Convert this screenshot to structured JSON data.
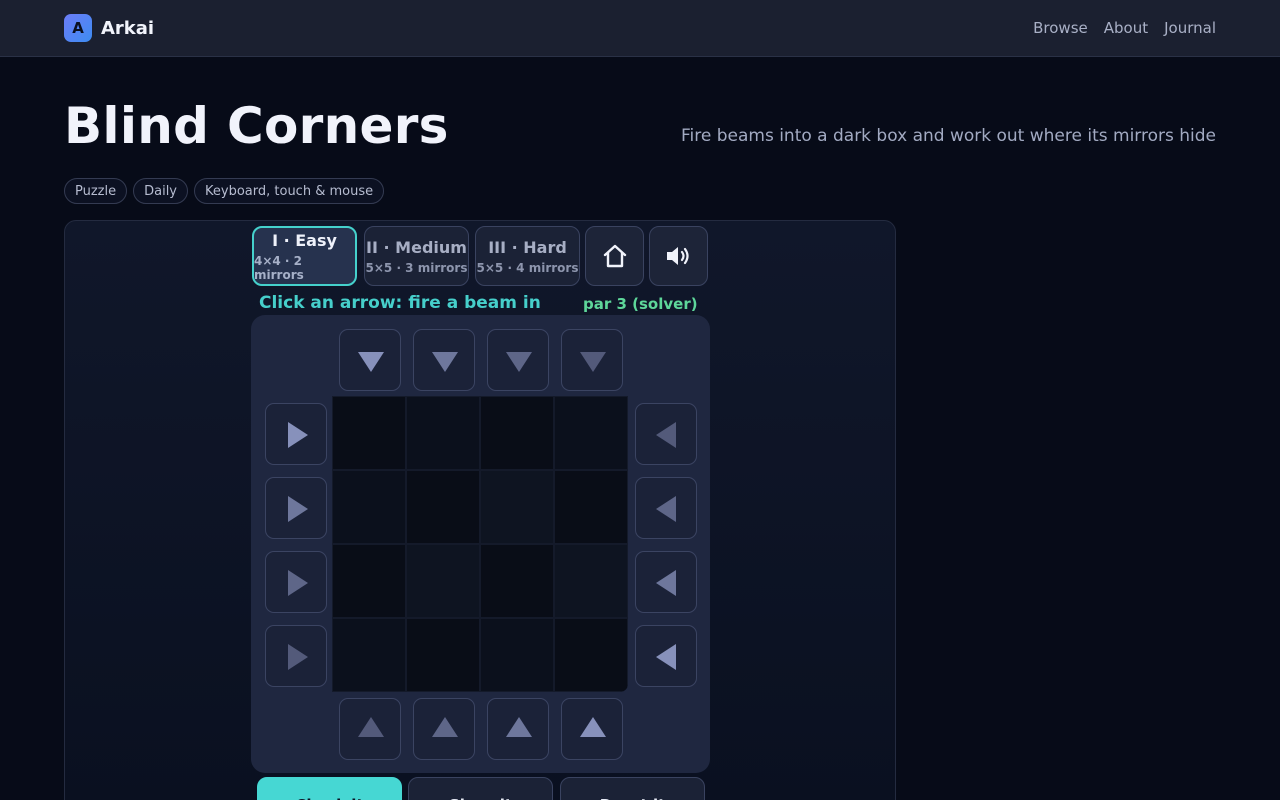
{
  "nav": {
    "brand_letter": "A",
    "brand_name": "Arkai",
    "links": [
      "Browse",
      "About",
      "Journal"
    ]
  },
  "header": {
    "title": "Blind Corners",
    "subtitle": "Fire beams into a dark box and work out where its mirrors hide",
    "tags": [
      "Puzzle",
      "Daily",
      "Keyboard, touch & mouse"
    ]
  },
  "levels": [
    {
      "name": "I · Easy",
      "desc": "4×4 · 2 mirrors",
      "active": true
    },
    {
      "name": "II · Medium",
      "desc": "5×5 · 3 mirrors",
      "active": false
    },
    {
      "name": "III · Hard",
      "desc": "5×5 · 4 mirrors",
      "active": false
    }
  ],
  "tools": {
    "home_icon": "home-icon",
    "sound_icon": "speaker-icon"
  },
  "game": {
    "status": "Click an arrow: fire a beam in",
    "par": "par 3 (solver)",
    "grid_size": 4
  },
  "actions": [
    "Check it",
    "Show it",
    "Reset it"
  ],
  "colors": {
    "accent": "#46d7d3",
    "par": "#5ed79a"
  }
}
